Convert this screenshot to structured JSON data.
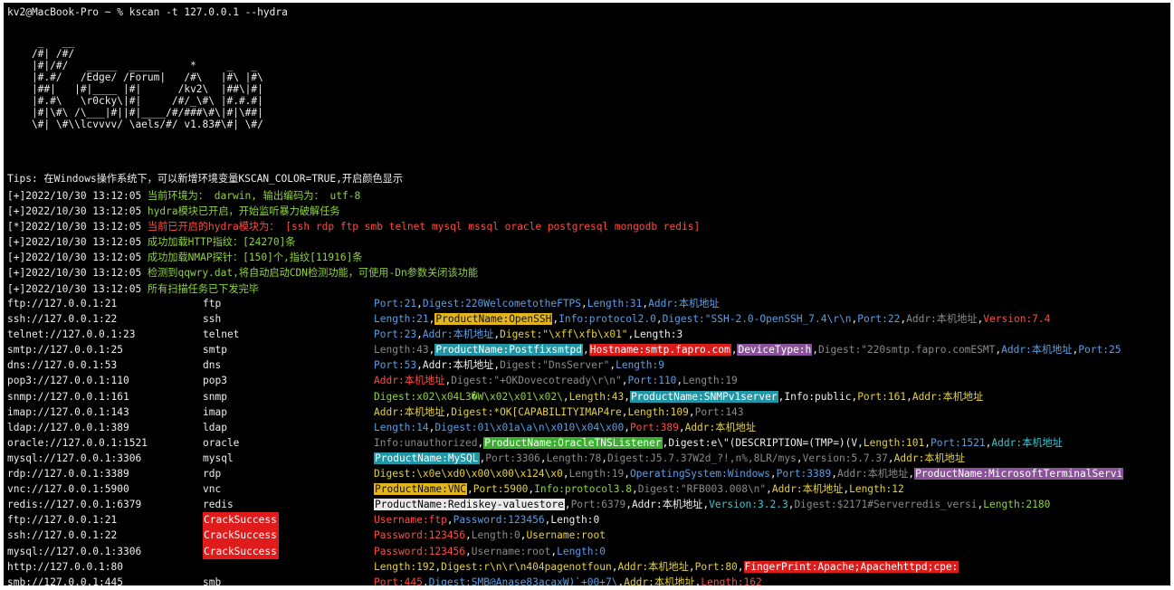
{
  "colors": {
    "white": "#ededed",
    "green": "#8fd53b",
    "red": "#ff4b41",
    "blue": "#5a9fe6",
    "cyan": "#38c9d6",
    "yellow": "#e6d23c",
    "gray": "#8a8a8a",
    "hl_yellow": "#e3b51c",
    "hl_red": "#de1b1b",
    "hl_cyan": "#1f97a6",
    "hl_purple": "#8a5299",
    "hl_white": "#e9e9e9",
    "hl_green": "#3ab02e",
    "crack_bg": "#e01b1b"
  },
  "prompt": "kv2@MacBook-Pro ~ % kscan -t 127.0.0.1 --hydra",
  "banner": [
    "     _   __",
    "    /#| /#/",
    "    |#|/#/   _____  _____     *     _   _",
    "    |#.#/   /Edge/ /Forum|   /#\\   |#\\ |#\\",
    "    |##|   |#|____ |#|      /kv2\\  |##\\|#|",
    "    |#.#\\   \\r0cky\\|#|     /#/_\\#\\ |#.#.#|",
    "    |#|\\#\\ /\\___|#||#|____/#/###\\#\\|#|\\##|",
    "    \\#| \\#\\\\lcvvvv/ \\aels/#/ v1.83#\\#| \\#/"
  ],
  "tips": "Tips: 在Windows操作系统下，可以新增环境变量KSCAN_COLOR=TRUE,开启颜色显示",
  "log": [
    {
      "prefix": "[+]2022/10/30 13:12:05 ",
      "msg": "当前环境为： darwin, 输出编码为： utf-8",
      "color": "green"
    },
    {
      "prefix": "[+]2022/10/30 13:12:05 ",
      "msg": "hydra模块已开启，开始监听暴力破解任务",
      "color": "green"
    },
    {
      "prefix": "[*]2022/10/30 13:12:05 ",
      "msg": "当前已开启的hydra模块为： [ssh rdp ftp smb telnet mysql mssql oracle postgresql mongodb redis]",
      "color": "red"
    },
    {
      "prefix": "[+]2022/10/30 13:12:05 ",
      "msg": "成功加载HTTP指纹：[24270]条",
      "color": "green"
    },
    {
      "prefix": "[+]2022/10/30 13:12:05 ",
      "msg": "成功加载NMAP探针：[150]个,指纹[11916]条",
      "color": "green"
    },
    {
      "prefix": "[+]2022/10/30 13:12:05 ",
      "msg": "检测到qqwry.dat,将自动启动CDN检测功能，可使用-Dn参数关闭该功能",
      "color": "green"
    },
    {
      "prefix": "[+]2022/10/30 13:12:05 ",
      "msg": "所有扫描任务已下发完毕",
      "color": "green"
    }
  ],
  "rows": [
    {
      "url": "ftp://127.0.0.1:21",
      "svc": "ftp",
      "segs": [
        [
          "Port:21",
          "blue"
        ],
        [
          ",",
          "white"
        ],
        [
          "Digest:220WelcometotheFTPS",
          "blue"
        ],
        [
          ",",
          "white"
        ],
        [
          "Length:31",
          "blue"
        ],
        [
          ",",
          "white"
        ],
        [
          "Addr:本机地址",
          "blue"
        ]
      ]
    },
    {
      "url": "ssh://127.0.0.1:22",
      "svc": "ssh",
      "segs": [
        [
          "Length:21",
          "blue"
        ],
        [
          ",",
          "white"
        ],
        [
          "ProductName:OpenSSH",
          "hl_yellow"
        ],
        [
          ",",
          "white"
        ],
        [
          "Info:protocol2.0",
          "blue"
        ],
        [
          ",",
          "white"
        ],
        [
          "Digest:\"SSH-2.0-OpenSSH_7.4\\r\\n",
          "blue"
        ],
        [
          ",",
          "white"
        ],
        [
          "Port:22",
          "blue"
        ],
        [
          ",",
          "white"
        ],
        [
          "Addr:本机地址",
          "gray"
        ],
        [
          ",",
          "white"
        ],
        [
          "Version:7.4",
          "red"
        ]
      ]
    },
    {
      "url": "telnet://127.0.0.1:23",
      "svc": "telnet",
      "segs": [
        [
          "Port:23",
          "blue"
        ],
        [
          ",",
          "white"
        ],
        [
          "Addr:本机地址",
          "blue"
        ],
        [
          ",",
          "white"
        ],
        [
          "Digest:\"\\xff\\xfb\\x01\"",
          "yellow"
        ],
        [
          ",",
          "white"
        ],
        [
          "Length:3",
          "white"
        ]
      ]
    },
    {
      "url": "smtp://127.0.0.1:25",
      "svc": "smtp",
      "segs": [
        [
          "Length:43",
          "gray"
        ],
        [
          ",",
          "white"
        ],
        [
          "ProductName:Postfixsmtpd",
          "hl_cyan"
        ],
        [
          ",",
          "white"
        ],
        [
          "Hostname:smtp.fapro.com",
          "hl_red"
        ],
        [
          ",",
          "white"
        ],
        [
          "DeviceType:h",
          "hl_purple"
        ],
        [
          ",",
          "white"
        ],
        [
          "Digest:\"220smtp.fapro.comESMT",
          "gray"
        ],
        [
          ",",
          "white"
        ],
        [
          "Addr:本机地址",
          "blue"
        ],
        [
          ",",
          "white"
        ],
        [
          "Port:25",
          "blue"
        ]
      ]
    },
    {
      "url": "dns://127.0.0.1:53",
      "svc": "dns",
      "segs": [
        [
          "Port:53",
          "blue"
        ],
        [
          ",",
          "white"
        ],
        [
          "Addr:本机地址",
          "white"
        ],
        [
          ",",
          "white"
        ],
        [
          "Digest:\"DnsServer\"",
          "gray"
        ],
        [
          ",",
          "white"
        ],
        [
          "Length:9",
          "blue"
        ]
      ]
    },
    {
      "url": "pop3://127.0.0.1:110",
      "svc": "pop3",
      "segs": [
        [
          "Addr:本机地址",
          "red"
        ],
        [
          ",",
          "white"
        ],
        [
          "Digest:\"+OKDovecotready\\r\\n\"",
          "gray"
        ],
        [
          ",",
          "white"
        ],
        [
          "Port:110",
          "blue"
        ],
        [
          ",",
          "white"
        ],
        [
          "Length:19",
          "gray"
        ]
      ]
    },
    {
      "url": "snmp://127.0.0.1:161",
      "svc": "snmp",
      "segs": [
        [
          "Digest:x02\\x04L3�W\\x02\\x01\\x02\\",
          "green"
        ],
        [
          ",",
          "white"
        ],
        [
          "Length:43",
          "yellow"
        ],
        [
          ",",
          "white"
        ],
        [
          "ProductName:SNMPv1server",
          "hl_cyan"
        ],
        [
          ",",
          "white"
        ],
        [
          "Info:public",
          "white"
        ],
        [
          ",",
          "white"
        ],
        [
          "Port:161",
          "yellow"
        ],
        [
          ",",
          "white"
        ],
        [
          "Addr:本机地址",
          "yellow"
        ]
      ]
    },
    {
      "url": "imap://127.0.0.1:143",
      "svc": "imap",
      "segs": [
        [
          "Addr:本机地址",
          "yellow"
        ],
        [
          ",",
          "white"
        ],
        [
          "Digest:*OK[CAPABILITYIMAP4re",
          "yellow"
        ],
        [
          ",",
          "white"
        ],
        [
          "Length:109",
          "yellow"
        ],
        [
          ",",
          "white"
        ],
        [
          "Port:143",
          "gray"
        ]
      ]
    },
    {
      "url": "ldap://127.0.0.1:389",
      "svc": "ldap",
      "segs": [
        [
          "Length:14",
          "blue"
        ],
        [
          ",",
          "white"
        ],
        [
          "Digest:01\\x01a\\a\\n\\x010\\x04\\x00",
          "blue"
        ],
        [
          ",",
          "white"
        ],
        [
          "Port:389",
          "red"
        ],
        [
          ",",
          "white"
        ],
        [
          "Addr:本机地址",
          "yellow"
        ]
      ]
    },
    {
      "url": "oracle://127.0.0.1:1521",
      "svc": "oracle",
      "segs": [
        [
          "Info:unauthorized",
          "gray"
        ],
        [
          ",",
          "white"
        ],
        [
          "ProductName:OracleTNSListener",
          "hl_green"
        ],
        [
          ",",
          "white"
        ],
        [
          "Digest:e\\\"(DESCRIPTION=(TMP=)(V",
          "white"
        ],
        [
          ",",
          "white"
        ],
        [
          "Length:101",
          "yellow"
        ],
        [
          ",",
          "white"
        ],
        [
          "Port:1521",
          "blue"
        ],
        [
          ",",
          "white"
        ],
        [
          "Addr:本机地址",
          "cyan"
        ]
      ]
    },
    {
      "url": "mysql://127.0.0.1:3306",
      "svc": "mysql",
      "segs": [
        [
          "ProductName:MySQL",
          "hl_cyan"
        ],
        [
          ",",
          "white"
        ],
        [
          "Port:3306",
          "gray"
        ],
        [
          ",",
          "white"
        ],
        [
          "Length:78",
          "gray"
        ],
        [
          ",",
          "white"
        ],
        [
          "Digest:J5.7.37W2d_?!,n%,8LR/mys",
          "gray"
        ],
        [
          ",",
          "white"
        ],
        [
          "Version:5.7.37",
          "gray"
        ],
        [
          ",",
          "white"
        ],
        [
          "Addr:本机地址",
          "yellow"
        ]
      ]
    },
    {
      "url": "rdp://127.0.0.1:3389",
      "svc": "rdp",
      "segs": [
        [
          "Digest:\\x0e\\xd0\\x00\\x00\\x124\\x0",
          "yellow"
        ],
        [
          ",",
          "white"
        ],
        [
          "Length:19",
          "gray"
        ],
        [
          ",",
          "white"
        ],
        [
          "OperatingSystem:Windows",
          "blue"
        ],
        [
          ",",
          "white"
        ],
        [
          "Port:3389",
          "blue"
        ],
        [
          ",",
          "white"
        ],
        [
          "Addr:本机地址",
          "gray"
        ],
        [
          ",",
          "white"
        ],
        [
          "ProductName:MicrosoftTerminalServi",
          "hl_purple"
        ]
      ]
    },
    {
      "url": "vnc://127.0.0.1:5900",
      "svc": "vnc",
      "segs": [
        [
          "ProductName:VNC",
          "hl_yellow"
        ],
        [
          ",",
          "white"
        ],
        [
          "Port:5900",
          "yellow"
        ],
        [
          ",",
          "white"
        ],
        [
          "Info:protocol3.8",
          "green"
        ],
        [
          ",",
          "white"
        ],
        [
          "Digest:\"RFB003.008\\n\"",
          "gray"
        ],
        [
          ",",
          "white"
        ],
        [
          "Addr:本机地址",
          "yellow"
        ],
        [
          ",",
          "white"
        ],
        [
          "Length:12",
          "yellow"
        ]
      ]
    },
    {
      "url": "redis://127.0.0.1:6379",
      "svc": "redis",
      "segs": [
        [
          "ProductName:Rediskey-valuestore",
          "hl_white"
        ],
        [
          ",",
          "white"
        ],
        [
          "Port:6379",
          "gray"
        ],
        [
          ",",
          "white"
        ],
        [
          "Addr:本机地址",
          "white"
        ],
        [
          ",",
          "white"
        ],
        [
          "Version:3.2.3",
          "cyan"
        ],
        [
          ",",
          "white"
        ],
        [
          "Digest:$2171#Serverredis_versi",
          "gray"
        ],
        [
          ",",
          "white"
        ],
        [
          "Length:2180",
          "green"
        ]
      ]
    },
    {
      "url": "ftp://127.0.0.1:21",
      "svc": "CrackSuccess",
      "crack": true,
      "segs": [
        [
          "Username:ftp",
          "red"
        ],
        [
          ",",
          "white"
        ],
        [
          "Password:123456",
          "blue"
        ],
        [
          ",",
          "white"
        ],
        [
          "Length:0",
          "white"
        ]
      ]
    },
    {
      "url": "ssh://127.0.0.1:22",
      "svc": "CrackSuccess",
      "crack": true,
      "segs": [
        [
          "Password:123456",
          "red"
        ],
        [
          ",",
          "white"
        ],
        [
          "Length:0",
          "gray"
        ],
        [
          ",",
          "white"
        ],
        [
          "Username:root",
          "yellow"
        ]
      ]
    },
    {
      "url": "mysql://127.0.0.1:3306",
      "svc": "CrackSuccess",
      "crack": true,
      "segs": [
        [
          "Password:123456",
          "red"
        ],
        [
          ",",
          "white"
        ],
        [
          "Username:root",
          "gray"
        ],
        [
          ",",
          "white"
        ],
        [
          "Length:0",
          "blue"
        ]
      ]
    },
    {
      "url": "http://127.0.0.1:80",
      "svc": "",
      "segs": [
        [
          "Length:192",
          "yellow"
        ],
        [
          ",",
          "white"
        ],
        [
          "Digest:r\\n\\r\\n404pagenotfoun",
          "yellow"
        ],
        [
          ",",
          "white"
        ],
        [
          "Addr:本机地址",
          "yellow"
        ],
        [
          ",",
          "white"
        ],
        [
          "Port:80",
          "yellow"
        ],
        [
          ",",
          "white"
        ],
        [
          "FingerPrint:Apache;Apachehttpd;cpe:",
          "hl_red"
        ]
      ]
    },
    {
      "url": "smb://127.0.0.1:445",
      "svc": "smb",
      "segs": [
        [
          "Port:445",
          "red"
        ],
        [
          ",",
          "white"
        ],
        [
          "Digest:SMB@Anase83acaxW)`+00+7\\",
          "blue"
        ],
        [
          ",",
          "white"
        ],
        [
          "Addr:本机地址",
          "yellow"
        ],
        [
          ",",
          "white"
        ],
        [
          "Length:162",
          "red"
        ]
      ]
    }
  ]
}
